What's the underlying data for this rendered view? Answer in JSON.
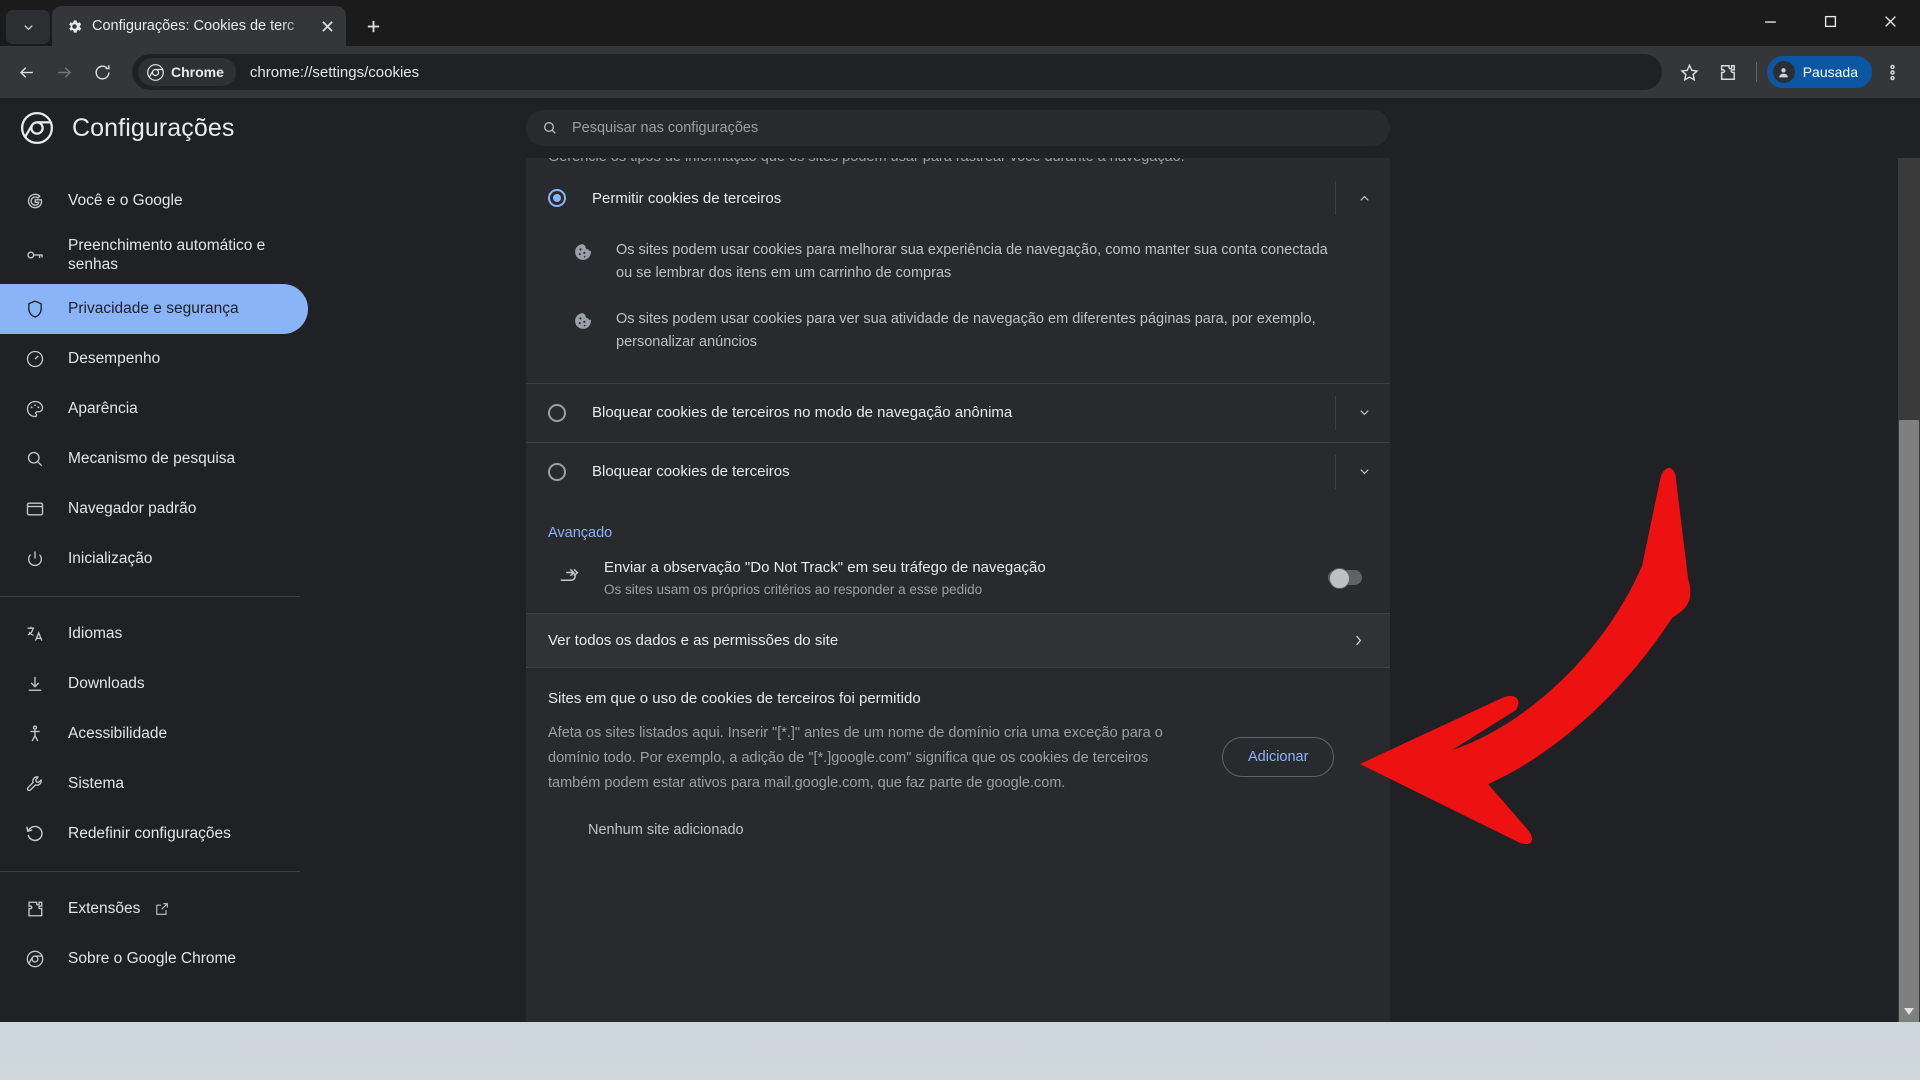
{
  "window": {
    "controls": {
      "minimize": "Minimizar",
      "maximize": "Maximizar",
      "close": "Fechar"
    }
  },
  "tabstrip": {
    "tab_search_tooltip": "Pesquisar guias",
    "tabs": [
      {
        "title": "Configurações: Cookies de terc",
        "favicon": "gear-icon",
        "active": true
      }
    ],
    "new_tab_label": "+"
  },
  "toolbar": {
    "back_tooltip": "Voltar",
    "forward_tooltip": "Avançar",
    "reload_tooltip": "Atualizar",
    "chip_label": "Chrome",
    "url": "chrome://settings/cookies",
    "bookmark_tooltip": "Criar favorito",
    "extensions_tooltip": "Extensões",
    "profile_label": "Pausada",
    "menu_tooltip": "Personalizar e controlar o Google Chrome"
  },
  "settings": {
    "title": "Configurações",
    "search": {
      "placeholder": "Pesquisar nas configurações",
      "value": ""
    }
  },
  "sidebar": {
    "items": [
      {
        "label": "Você e o Google",
        "icon": "google-g-icon",
        "active": false
      },
      {
        "label": "Preenchimento automático e senhas",
        "icon": "key-icon",
        "active": false
      },
      {
        "label": "Privacidade e segurança",
        "icon": "shield-icon",
        "active": true
      },
      {
        "label": "Desempenho",
        "icon": "gauge-icon",
        "active": false
      },
      {
        "label": "Aparência",
        "icon": "palette-icon",
        "active": false
      },
      {
        "label": "Mecanismo de pesquisa",
        "icon": "search-icon",
        "active": false
      },
      {
        "label": "Navegador padrão",
        "icon": "browser-window-icon",
        "active": false
      },
      {
        "label": "Inicialização",
        "icon": "power-icon",
        "active": false
      }
    ],
    "items2": [
      {
        "label": "Idiomas",
        "icon": "translate-icon"
      },
      {
        "label": "Downloads",
        "icon": "download-icon"
      },
      {
        "label": "Acessibilidade",
        "icon": "accessibility-icon"
      },
      {
        "label": "Sistema",
        "icon": "wrench-icon"
      },
      {
        "label": "Redefinir configurações",
        "icon": "reset-icon"
      }
    ],
    "items3": [
      {
        "label": "Extensões",
        "icon": "puzzle-icon",
        "external": true
      },
      {
        "label": "Sobre o Google Chrome",
        "icon": "chrome-icon",
        "external": false
      }
    ]
  },
  "content": {
    "clipped_header": "Gerencie os tipos de informação que os sites podem usar para rastrear você durante a navegação.",
    "options": [
      {
        "label": "Permitir cookies de terceiros",
        "selected": true,
        "expanded": true,
        "bullets": [
          "Os sites podem usar cookies para melhorar sua experiência de navegação, como manter sua conta conectada ou se lembrar dos itens em um carrinho de compras",
          "Os sites podem usar cookies para ver sua atividade de navegação em diferentes páginas para, por exemplo, personalizar anúncios"
        ]
      },
      {
        "label": "Bloquear cookies de terceiros no modo de navegação anônima",
        "selected": false,
        "expanded": false,
        "bullets": []
      },
      {
        "label": "Bloquear cookies de terceiros",
        "selected": false,
        "expanded": false,
        "bullets": []
      }
    ],
    "advanced_title": "Avançado",
    "do_not_track": {
      "title": "Enviar a observação \"Do Not Track\" em seu tráfego de navegação",
      "subtitle": "Os sites usam os próprios critérios ao responder a esse pedido",
      "enabled": false
    },
    "all_site_data_link": "Ver todos os dados e as permissões do site",
    "sites_section": {
      "title": "Sites em que o uso de cookies de terceiros foi permitido",
      "description": "Afeta os sites listados aqui. Inserir \"[*.]\" antes de um nome de domínio cria uma exceção para o domínio todo. Por exemplo, a adição de \"[*.]google.com\" significa que os cookies de terceiros também podem estar ativos para mail.google.com, que faz parte de google.com.",
      "add_button": "Adicionar",
      "empty_state": "Nenhum site adicionado"
    }
  },
  "annotation": {
    "arrow_color": "#ee1111",
    "points_at": "Ver todos os dados e as permissões do site"
  },
  "colors": {
    "accent": "#8ab4f8",
    "page_bg": "#292a2d",
    "chrome_bg": "#202124",
    "toolbar_bg": "#35363a",
    "profile_pill": "#0b57a4",
    "annotation_red": "#ee1111"
  }
}
